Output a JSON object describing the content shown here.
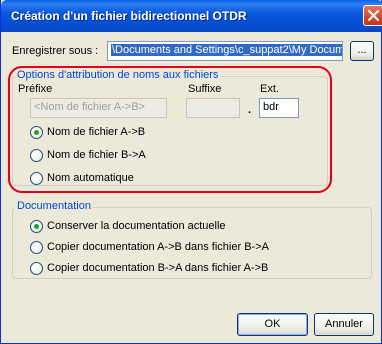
{
  "dialog": {
    "title": "Création d'un fichier bidirectionnel OTDR",
    "close_glyph": "✕"
  },
  "save": {
    "label": "Enregistrer sous :",
    "path_value": "\\Documents and Settings\\c_suppat2\\My Documents",
    "browse_label": "..."
  },
  "naming": {
    "group_title": "Options d'attribution de noms aux fichiers",
    "prefix_label": "Préfixe",
    "suffix_label": "Suffixe",
    "ext_label": "Ext.",
    "prefix_placeholder": "<Nom de fichier A->B>",
    "suffix_value": "",
    "dot": ".",
    "ext_value": "bdr",
    "options": [
      {
        "label": "Nom de fichier A->B",
        "selected": true
      },
      {
        "label": "Nom de fichier B->A",
        "selected": false
      },
      {
        "label": "Nom automatique",
        "selected": false
      }
    ]
  },
  "documentation": {
    "group_title": "Documentation",
    "options": [
      {
        "label": "Conserver la documentation actuelle",
        "selected": true
      },
      {
        "label": "Copier documentation A->B dans fichier B->A",
        "selected": false
      },
      {
        "label": "Copier documentation B->A dans fichier A->B",
        "selected": false
      }
    ]
  },
  "buttons": {
    "ok_label": "OK",
    "cancel_label": "Annuler"
  },
  "colors": {
    "title_bar": "#0a5fe8",
    "dialog_bg": "#ece9d8",
    "group_title": "#0046d5",
    "radio_dot": "#21a121",
    "annotation_outline": "#e0001b"
  }
}
